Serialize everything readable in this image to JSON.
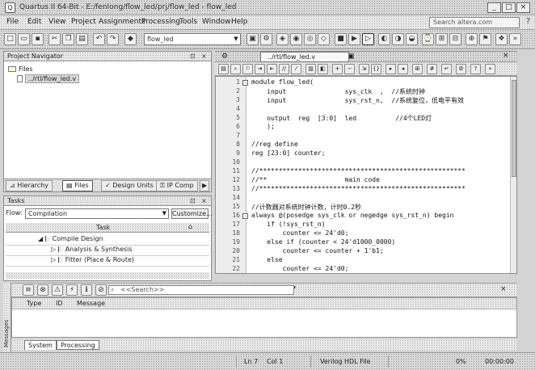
{
  "window": {
    "title": "Quartus II 64-Bit - E:/fenlong/flow_led/prj/flow_led - flow_led",
    "buttons": [
      "_",
      "□",
      "×"
    ]
  },
  "menubar": {
    "items": [
      "File",
      "Edit",
      "View",
      "Project",
      "Assignments",
      "Processing",
      "Tools",
      "Window",
      "Help"
    ],
    "search_placeholder": "Search altera.com",
    "help_icon": "?"
  },
  "toolbar": {
    "project_combo": "flow_led"
  },
  "project_navigator": {
    "title": "Project Navigator",
    "root_label": "Files",
    "file_item": "../rtl/flow_led.v",
    "tabs": [
      "Hierarchy",
      "Files",
      "Design Units",
      "IP Comp"
    ]
  },
  "tasks": {
    "title": "Tasks",
    "flow_label": "Flow:",
    "flow_value": "Compilation",
    "customize_label": "Customize...",
    "column_header": "Task",
    "items": [
      {
        "label": "Compile Design",
        "indent": 0
      },
      {
        "label": "Analysis & Synthesis",
        "indent": 1
      },
      {
        "label": "Fitter (Place & Route)",
        "indent": 1
      }
    ]
  },
  "editor": {
    "tab_label": "../rtl/flow_led.v",
    "lines": [
      {
        "no": "1",
        "text": "module flow_led(",
        "fold": "-"
      },
      {
        "no": "2",
        "text": "    input               sys_clk  ,  //系统时钟",
        "fold": ""
      },
      {
        "no": "3",
        "text": "    input               sys_rst_n,  //系统复位，低电平有效",
        "fold": ""
      },
      {
        "no": "4",
        "text": "",
        "fold": ""
      },
      {
        "no": "5",
        "text": "    output  reg  [3:0]  led          //4个LED灯",
        "fold": ""
      },
      {
        "no": "6",
        "text": "    );",
        "fold": ""
      },
      {
        "no": "7",
        "text": "",
        "fold": ""
      },
      {
        "no": "8",
        "text": "//reg define",
        "fold": ""
      },
      {
        "no": "9",
        "text": "reg [23:0] counter;",
        "fold": ""
      },
      {
        "no": "10",
        "text": "",
        "fold": ""
      },
      {
        "no": "11",
        "text": "//*****************************************************",
        "fold": ""
      },
      {
        "no": "12",
        "text": "//**                    main code",
        "fold": ""
      },
      {
        "no": "13",
        "text": "//*****************************************************",
        "fold": ""
      },
      {
        "no": "14",
        "text": "",
        "fold": ""
      },
      {
        "no": "15",
        "text": "//计数器对系统时钟计数，计时0.2秒",
        "fold": ""
      },
      {
        "no": "16",
        "text": "always @(posedge sys_clk or negedge sys_rst_n) begin",
        "fold": "-"
      },
      {
        "no": "17",
        "text": "    if (!sys_rst_n)",
        "fold": ""
      },
      {
        "no": "18",
        "text": "        counter <= 24'd0;",
        "fold": ""
      },
      {
        "no": "19",
        "text": "    else if (counter < 24'd1000_0000)",
        "fold": ""
      },
      {
        "no": "20",
        "text": "        counter <= counter + 1'b1;",
        "fold": ""
      },
      {
        "no": "21",
        "text": "    else",
        "fold": ""
      },
      {
        "no": "22",
        "text": "        counter <= 24'd0;",
        "fold": ""
      }
    ]
  },
  "messages": {
    "filter_placeholder": "<<Search>>",
    "columns": [
      "Type",
      "ID",
      "Message"
    ],
    "side_label": "Messages",
    "tabs": [
      "System",
      "Processing"
    ]
  },
  "statusbar": {
    "position": "Ln 7",
    "column": "Col 1",
    "file_type": "Verilog HDL File",
    "progress": "0%",
    "elapsed": "00:00:00"
  }
}
